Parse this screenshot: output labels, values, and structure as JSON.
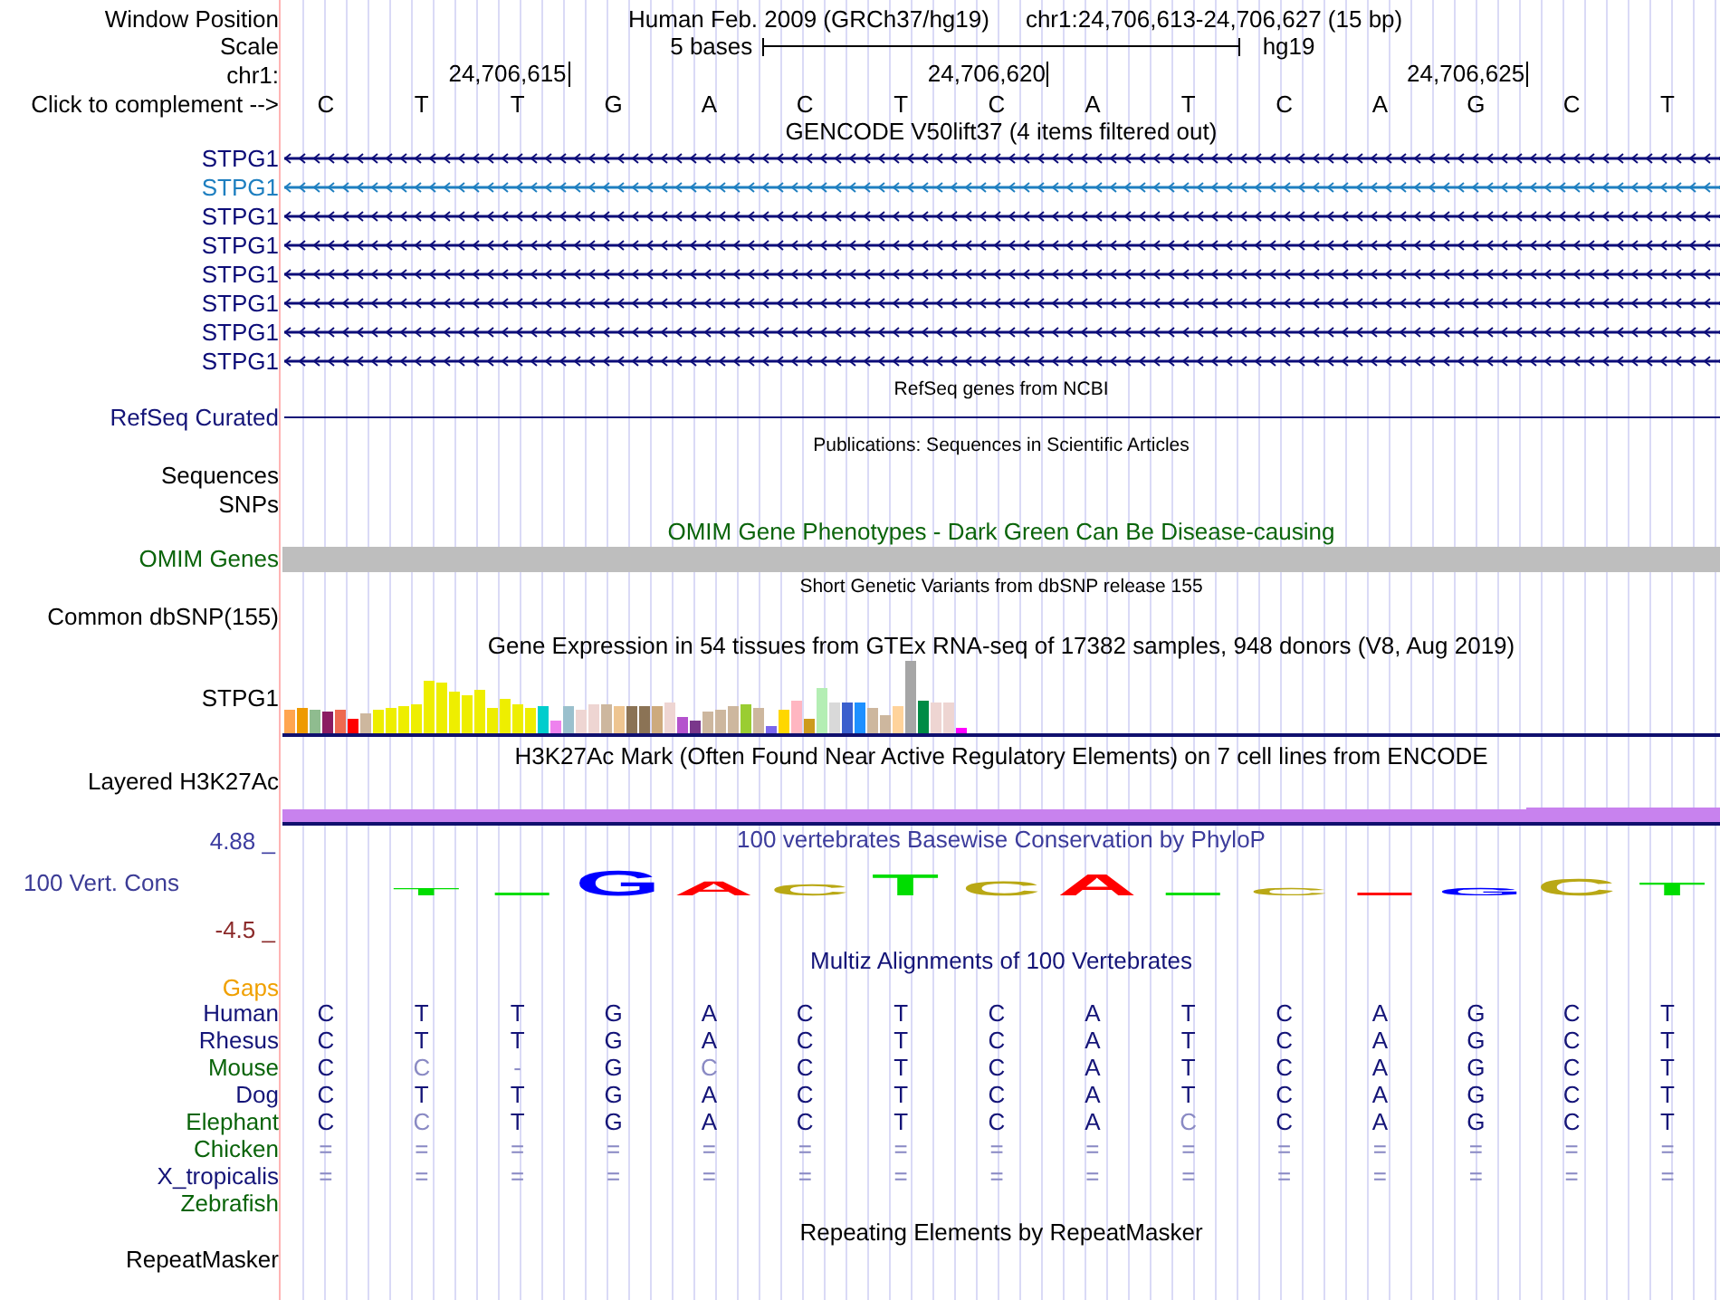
{
  "header": {
    "label": "Window Position",
    "assembly": "Human Feb. 2009 (GRCh37/hg19)",
    "position": "chr1:24,706,613-24,706,627 (15 bp)"
  },
  "scale": {
    "label": "Scale",
    "length": "5 bases",
    "assembly": "hg19"
  },
  "ruler": {
    "label": "chr1:",
    "ticks": [
      "24,706,615",
      "24,706,620",
      "24,706,625"
    ]
  },
  "sequence": {
    "label": "Click to complement -->",
    "bases": [
      "C",
      "T",
      "T",
      "G",
      "A",
      "C",
      "T",
      "C",
      "A",
      "T",
      "C",
      "A",
      "G",
      "C",
      "T"
    ]
  },
  "gencode": {
    "title": "GENCODE V50lift37 (4 items filtered out)",
    "items": [
      {
        "name": "STPG1",
        "color": "#0c0c78"
      },
      {
        "name": "STPG1",
        "color": "#1e7fc0"
      },
      {
        "name": "STPG1",
        "color": "#0c0c78"
      },
      {
        "name": "STPG1",
        "color": "#0c0c78"
      },
      {
        "name": "STPG1",
        "color": "#0c0c78"
      },
      {
        "name": "STPG1",
        "color": "#0c0c78"
      },
      {
        "name": "STPG1",
        "color": "#0c0c78"
      },
      {
        "name": "STPG1",
        "color": "#0c0c78"
      }
    ]
  },
  "refseq": {
    "title": "RefSeq genes from NCBI",
    "label": "RefSeq Curated"
  },
  "publications": {
    "title": "Publications: Sequences in Scientific Articles",
    "labels": [
      "Sequences",
      "SNPs"
    ]
  },
  "omim": {
    "title": "OMIM Gene Phenotypes - Dark Green Can Be Disease-causing",
    "label": "OMIM Genes"
  },
  "dbsnp": {
    "title": "Short Genetic Variants from dbSNP release 155",
    "label": "Common dbSNP(155)"
  },
  "gtex": {
    "title": "Gene Expression in 54 tissues from GTEx RNA-seq of 17382 samples, 948 donors (V8, Aug 2019)",
    "label": "STPG1"
  },
  "h3k27ac": {
    "title": "H3K27Ac Mark (Often Found Near Active Regulatory Elements) on 7 cell lines from ENCODE",
    "label": "Layered H3K27Ac"
  },
  "conservation": {
    "title": "100 vertebrates Basewise Conservation by PhyloP",
    "label": "100 Vert. Cons",
    "axis_max": "4.88 _",
    "axis_min": "-4.5 _",
    "logo": [
      {
        "kind": "letter",
        "base": "T",
        "color": "#00dd00"
      },
      {
        "kind": "dash",
        "color": "#00dd00"
      },
      {
        "kind": "letter",
        "base": "G",
        "color": "#0000ff"
      },
      {
        "kind": "letter",
        "base": "A",
        "color": "#ff0000"
      },
      {
        "kind": "letter",
        "base": "C",
        "color": "#b9a815"
      },
      {
        "kind": "letter",
        "base": "T",
        "color": "#00dd00"
      },
      {
        "kind": "letter",
        "base": "C",
        "color": "#b9a815"
      },
      {
        "kind": "letter",
        "base": "A",
        "color": "#ff0000"
      },
      {
        "kind": "dash",
        "color": "#00dd00"
      },
      {
        "kind": "letter",
        "base": "C",
        "color": "#b9a815"
      },
      {
        "kind": "dash",
        "color": "#ff0000"
      },
      {
        "kind": "letter",
        "base": "G",
        "color": "#0000ff"
      },
      {
        "kind": "letter",
        "base": "C",
        "color": "#b9a815"
      },
      {
        "kind": "letter",
        "base": "T",
        "color": "#00dd00"
      }
    ]
  },
  "multiz": {
    "title": "Multiz Alignments of 100 Vertebrates",
    "gaps_label": "Gaps",
    "species": [
      {
        "name": "Human",
        "color": "#141478",
        "bases": [
          {
            "base": "C",
            "match": true
          },
          {
            "base": "T",
            "match": true
          },
          {
            "base": "T",
            "match": true
          },
          {
            "base": "G",
            "match": true
          },
          {
            "base": "A",
            "match": true
          },
          {
            "base": "C",
            "match": true
          },
          {
            "base": "T",
            "match": true
          },
          {
            "base": "C",
            "match": true
          },
          {
            "base": "A",
            "match": true
          },
          {
            "base": "T",
            "match": true
          },
          {
            "base": "C",
            "match": true
          },
          {
            "base": "A",
            "match": true
          },
          {
            "base": "G",
            "match": true
          },
          {
            "base": "C",
            "match": true
          },
          {
            "base": "T",
            "match": true
          }
        ]
      },
      {
        "name": "Rhesus",
        "color": "#141478",
        "bases": [
          {
            "base": "C",
            "match": true
          },
          {
            "base": "T",
            "match": true
          },
          {
            "base": "T",
            "match": true
          },
          {
            "base": "G",
            "match": true
          },
          {
            "base": "A",
            "match": true
          },
          {
            "base": "C",
            "match": true
          },
          {
            "base": "T",
            "match": true
          },
          {
            "base": "C",
            "match": true
          },
          {
            "base": "A",
            "match": true
          },
          {
            "base": "T",
            "match": true
          },
          {
            "base": "C",
            "match": true
          },
          {
            "base": "A",
            "match": true
          },
          {
            "base": "G",
            "match": true
          },
          {
            "base": "C",
            "match": true
          },
          {
            "base": "T",
            "match": true
          }
        ]
      },
      {
        "name": "Mouse",
        "color": "#0a640a",
        "bases": [
          {
            "base": "C",
            "match": true
          },
          {
            "base": "C",
            "match": false
          },
          {
            "base": "-",
            "match": false
          },
          {
            "base": "G",
            "match": true
          },
          {
            "base": "C",
            "match": false
          },
          {
            "base": "C",
            "match": true
          },
          {
            "base": "T",
            "match": true
          },
          {
            "base": "C",
            "match": true
          },
          {
            "base": "A",
            "match": true
          },
          {
            "base": "T",
            "match": true
          },
          {
            "base": "C",
            "match": true
          },
          {
            "base": "A",
            "match": true
          },
          {
            "base": "G",
            "match": true
          },
          {
            "base": "C",
            "match": true
          },
          {
            "base": "T",
            "match": true
          }
        ]
      },
      {
        "name": "Dog",
        "color": "#141478",
        "bases": [
          {
            "base": "C",
            "match": true
          },
          {
            "base": "T",
            "match": true
          },
          {
            "base": "T",
            "match": true
          },
          {
            "base": "G",
            "match": true
          },
          {
            "base": "A",
            "match": true
          },
          {
            "base": "C",
            "match": true
          },
          {
            "base": "T",
            "match": true
          },
          {
            "base": "C",
            "match": true
          },
          {
            "base": "A",
            "match": true
          },
          {
            "base": "T",
            "match": true
          },
          {
            "base": "C",
            "match": true
          },
          {
            "base": "A",
            "match": true
          },
          {
            "base": "G",
            "match": true
          },
          {
            "base": "C",
            "match": true
          },
          {
            "base": "T",
            "match": true
          }
        ]
      },
      {
        "name": "Elephant",
        "color": "#0a640a",
        "bases": [
          {
            "base": "C",
            "match": true
          },
          {
            "base": "C",
            "match": false
          },
          {
            "base": "T",
            "match": true
          },
          {
            "base": "G",
            "match": true
          },
          {
            "base": "A",
            "match": true
          },
          {
            "base": "C",
            "match": true
          },
          {
            "base": "T",
            "match": true
          },
          {
            "base": "C",
            "match": true
          },
          {
            "base": "A",
            "match": true
          },
          {
            "base": "C",
            "match": false
          },
          {
            "base": "C",
            "match": true
          },
          {
            "base": "A",
            "match": true
          },
          {
            "base": "G",
            "match": true
          },
          {
            "base": "C",
            "match": true
          },
          {
            "base": "T",
            "match": true
          }
        ]
      },
      {
        "name": "Chicken",
        "color": "#0a640a",
        "bases": [
          {
            "base": "=",
            "match": false
          },
          {
            "base": "=",
            "match": false
          },
          {
            "base": "=",
            "match": false
          },
          {
            "base": "=",
            "match": false
          },
          {
            "base": "=",
            "match": false
          },
          {
            "base": "=",
            "match": false
          },
          {
            "base": "=",
            "match": false
          },
          {
            "base": "=",
            "match": false
          },
          {
            "base": "=",
            "match": false
          },
          {
            "base": "=",
            "match": false
          },
          {
            "base": "=",
            "match": false
          },
          {
            "base": "=",
            "match": false
          },
          {
            "base": "=",
            "match": false
          },
          {
            "base": "=",
            "match": false
          },
          {
            "base": "=",
            "match": false
          }
        ]
      },
      {
        "name": "X_tropicalis",
        "color": "#141478",
        "bases": [
          {
            "base": "=",
            "match": false
          },
          {
            "base": "=",
            "match": false
          },
          {
            "base": "=",
            "match": false
          },
          {
            "base": "=",
            "match": false
          },
          {
            "base": "=",
            "match": false
          },
          {
            "base": "=",
            "match": false
          },
          {
            "base": "=",
            "match": false
          },
          {
            "base": "=",
            "match": false
          },
          {
            "base": "=",
            "match": false
          },
          {
            "base": "=",
            "match": false
          },
          {
            "base": "=",
            "match": false
          },
          {
            "base": "=",
            "match": false
          },
          {
            "base": "=",
            "match": false
          },
          {
            "base": "=",
            "match": false
          },
          {
            "base": "=",
            "match": false
          }
        ]
      },
      {
        "name": "Zebrafish",
        "color": "#0a640a"
      }
    ]
  },
  "repeatmasker": {
    "title": "Repeating Elements by RepeatMasker",
    "label": "RepeatMasker"
  }
}
